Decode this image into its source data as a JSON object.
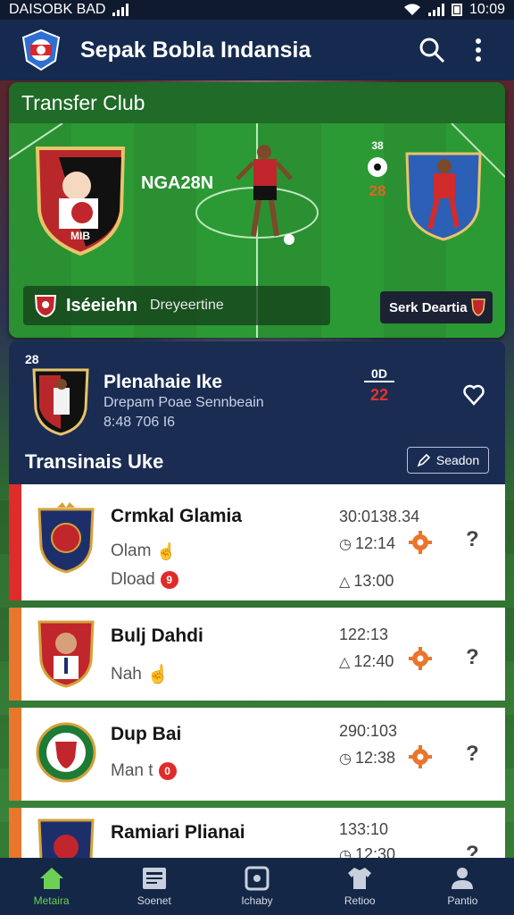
{
  "status_bar": {
    "carrier": "DAISOBK BAD",
    "time": "10:09"
  },
  "app": {
    "title": "Sepak Bobla Indansia"
  },
  "club_card": {
    "header": "Transfer Club",
    "player_name": "NGA28N",
    "score_top": "38",
    "score_value": "28",
    "club_name": "Iséeiehn",
    "club_sub": "Dreyeertine",
    "search_label": "Serk Deartia",
    "crest_text": "MIB"
  },
  "featured": {
    "tiny_label": "28",
    "name": "Plenahaie Ike",
    "description": "Drepam Poae Sennbeain",
    "meta": "8:48 706 I6",
    "score_a": "0D",
    "score_b": "22",
    "section_title": "Transinais Uke",
    "section_button": "Seadon"
  },
  "list": [
    {
      "title": "Crmkal Glamia",
      "line2": "Olam",
      "line3": "Dload",
      "line3_badge": "9",
      "time_top": "30:0138.34",
      "time_mid": "12:14",
      "time_bot": "13:00",
      "accent": "#e02b2b"
    },
    {
      "title": "Bulj Dahdi",
      "line2": "Nah",
      "time_top": "122:13",
      "time_mid": "12:40",
      "accent": "#e8762c"
    },
    {
      "title": "Dup Bai",
      "line2": "Man t",
      "line2_badge": "0",
      "time_top": "290:103",
      "time_mid": "12:38",
      "accent": "#e8762c"
    },
    {
      "title": "Ramiari Plianai",
      "time_top": "133:10",
      "time_mid": "12:30",
      "accent": "#e8762c"
    }
  ],
  "nav": [
    {
      "label": "Metaira",
      "icon": "home-icon",
      "active": true
    },
    {
      "label": "Soenet",
      "icon": "news-icon",
      "active": false
    },
    {
      "label": "Ichaby",
      "icon": "square-icon",
      "active": false
    },
    {
      "label": "Retioo",
      "icon": "shirt-icon",
      "active": false
    },
    {
      "label": "Pantio",
      "icon": "person-icon",
      "active": false
    }
  ],
  "colors": {
    "appbar": "#152a4e",
    "accent_green": "#6dcf54",
    "accent_orange": "#e8762c",
    "accent_red": "#e02b2b"
  }
}
